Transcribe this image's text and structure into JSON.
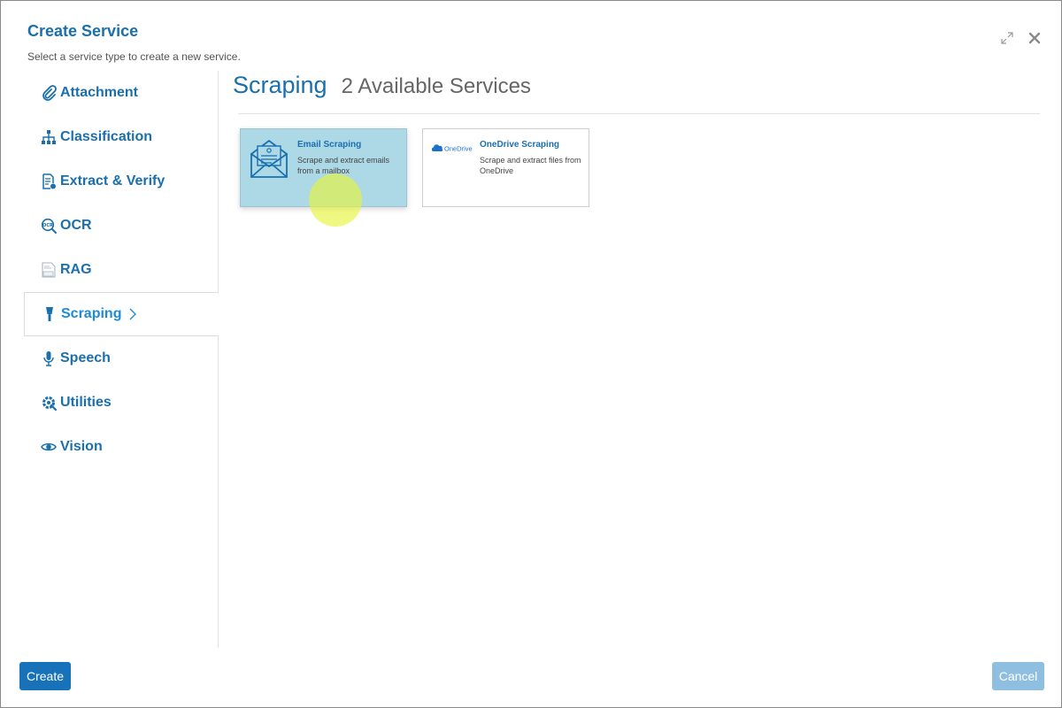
{
  "dialog": {
    "title": "Create Service",
    "subtitle": "Select a service type to create a new service."
  },
  "window_controls": {
    "expand_icon": "expand-icon",
    "close_icon": "close-icon"
  },
  "sidebar": {
    "items": [
      {
        "label": "Attachment",
        "icon": "paperclip-icon"
      },
      {
        "label": "Classification",
        "icon": "hierarchy-icon"
      },
      {
        "label": "Extract & Verify",
        "icon": "document-check-icon"
      },
      {
        "label": "OCR",
        "icon": "ocr-icon"
      },
      {
        "label": "RAG",
        "icon": "rag-document-icon"
      },
      {
        "label": "Scraping",
        "icon": "scraper-icon",
        "active": true
      },
      {
        "label": "Speech",
        "icon": "microphone-icon"
      },
      {
        "label": "Utilities",
        "icon": "gear-tools-icon"
      },
      {
        "label": "Vision",
        "icon": "eye-icon"
      }
    ]
  },
  "content": {
    "title": "Scraping",
    "count_label": "2 Available Services"
  },
  "services": [
    {
      "title": "Email Scraping",
      "description": "Scrape and extract emails from a mailbox",
      "icon": "email-envelope-icon",
      "selected": true
    },
    {
      "title": "OneDrive Scraping",
      "description": "Scrape and extract files from OneDrive",
      "icon": "onedrive-logo-icon",
      "logo_text": "OneDrive",
      "selected": false
    }
  ],
  "footer": {
    "create_label": "Create",
    "cancel_label": "Cancel"
  },
  "colors": {
    "accent": "#1a6fae",
    "active_nav": "#1e8ad6",
    "selected_card": "#add8e6",
    "create_button": "#1772b9",
    "cancel_button": "#8fbfe0"
  }
}
